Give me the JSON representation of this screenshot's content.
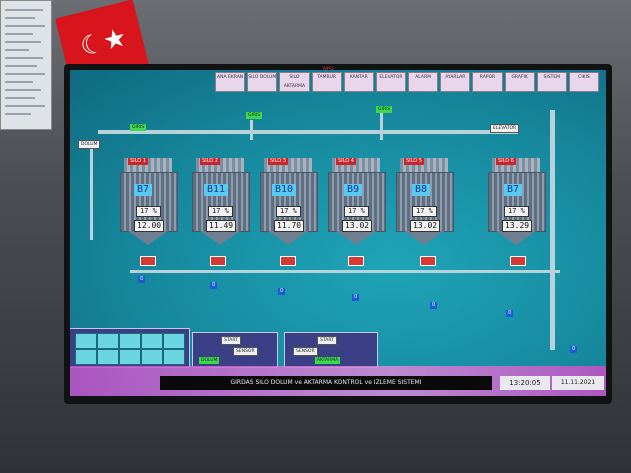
{
  "header": {
    "brand": "MSI",
    "buttons": [
      "ANA EKRAN",
      "SILO DOLUM",
      "SILO AKTARMA",
      "TAMBUR",
      "KANTAR",
      "ELEVATOR",
      "ALARM",
      "AYARLAR",
      "RAPOR",
      "GRAFIK",
      "SISTEM",
      "CIKIS"
    ]
  },
  "silos": [
    {
      "id": "S1",
      "tag": "SILO 1",
      "level": "B7",
      "percent": "17 %",
      "tons": "12.00"
    },
    {
      "id": "S2",
      "tag": "SILO 2",
      "level": "B11",
      "percent": "17 %",
      "tons": "11.49"
    },
    {
      "id": "S3",
      "tag": "SILO 3",
      "level": "B10",
      "percent": "17 %",
      "tons": "11.70"
    },
    {
      "id": "S4",
      "tag": "SILO 4",
      "level": "B9",
      "percent": "17 %",
      "tons": "13.02"
    },
    {
      "id": "S5",
      "tag": "SILO 5",
      "level": "B8",
      "percent": "17 %",
      "tons": "13.02"
    },
    {
      "id": "S6",
      "tag": "SILO 6",
      "level": "B7",
      "percent": "17 %",
      "tons": "13.29"
    }
  ],
  "conveyor": {
    "values": [
      "0",
      "0",
      "0",
      "0",
      "0",
      "0",
      "0"
    ]
  },
  "controls": {
    "panel1_title": "START",
    "panel2_title": "START",
    "sensor1": "SENSOR",
    "sensor2": "SENSOR",
    "mode_label": "AKTARMA"
  },
  "status": {
    "text": "GIRDAS SILO DOLUM ve AKTARMA KONTROL ve IZLEME SISTEMI",
    "time": "13:20:05",
    "date": "11.11.2021"
  },
  "colors": {
    "screen_bg": "#16889d",
    "tag_red": "#c8262a",
    "level_blue": "#5ac8f0",
    "green": "#3fd84a",
    "magenta": "#c54fc9"
  }
}
